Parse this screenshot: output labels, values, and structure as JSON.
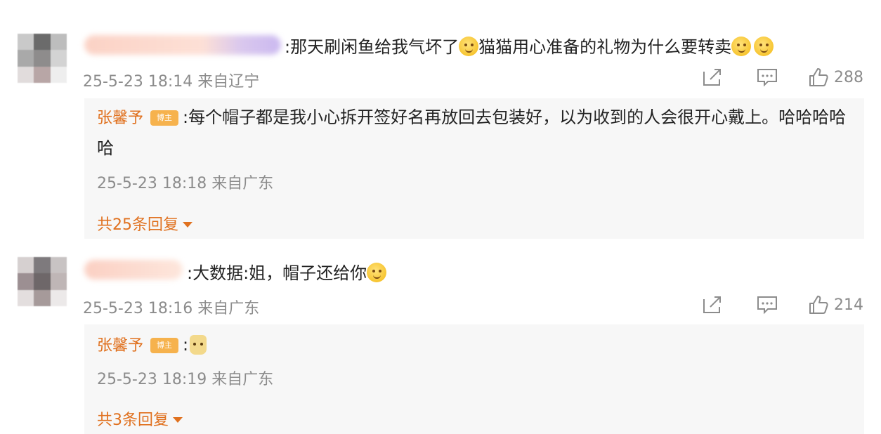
{
  "comments": [
    {
      "text_pre": ":那天刷闲鱼给我气坏了",
      "text_mid": "猫猫用心准备的礼物为什么要转卖",
      "meta": "25-5-23 18:14 来自辽宁",
      "likes": "288",
      "reply": {
        "author": "张馨予",
        "badge": "博主",
        "text": ":每个帽子都是我小心拆开签好名再放回去包装好，以为收到的人会很开心戴上。哈哈哈哈哈",
        "meta": "25-5-23 18:18 来自广东",
        "more": "共25条回复"
      }
    },
    {
      "text_pre": ":大数据:姐，帽子还给你",
      "meta": "25-5-23 18:16 来自广东",
      "likes": "214",
      "reply": {
        "author": "张馨予",
        "badge": "博主",
        "text": ":",
        "meta": "25-5-23 18:19 来自广东",
        "more": "共3条回复"
      }
    }
  ],
  "icons": {
    "share": "share-icon",
    "comment": "comment-icon",
    "like": "thumbs-up-icon",
    "emoji": "smile-emoji-icon",
    "cat": "cat-sticker-icon"
  },
  "colors": {
    "author": "#e0711f",
    "badge": "#f6b24d",
    "meta": "#8c8c8c",
    "reply_bg": "#f7f7f7"
  }
}
